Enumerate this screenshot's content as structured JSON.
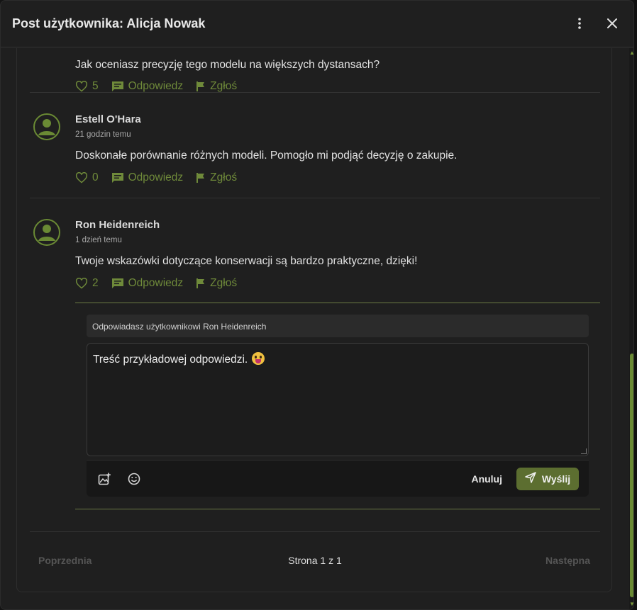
{
  "modal": {
    "title": "Post użytkownika: Alicja Nowak",
    "more_icon": "more-vertical-icon",
    "close_icon": "close-icon"
  },
  "comments": [
    {
      "text": "Jak oceniasz precyzję tego modelu na większych dystansach?",
      "likes": "5",
      "reply_label": "Odpowiedz",
      "report_label": "Zgłoś"
    },
    {
      "author": "Estell O'Hara",
      "time": "21 godzin temu",
      "text": "Doskonałe porównanie różnych modeli. Pomogło mi podjąć decyzję o zakupie.",
      "likes": "0",
      "reply_label": "Odpowiedz",
      "report_label": "Zgłoś"
    },
    {
      "author": "Ron Heidenreich",
      "time": "1 dzień temu",
      "text": "Twoje wskazówki dotyczące konserwacji są bardzo praktyczne, dzięki!",
      "likes": "2",
      "reply_label": "Odpowiedz",
      "report_label": "Zgłoś"
    }
  ],
  "reply_form": {
    "replying_to": "Odpowiadasz użytkownikowi Ron Heidenreich",
    "value": "Treść przykładowej odpowiedzi.",
    "emoji": "zany-face-emoji",
    "cancel_label": "Anuluj",
    "send_label": "Wyślij"
  },
  "pagination": {
    "prev_label": "Poprzednia",
    "page_label": "Strona 1 z 1",
    "next_label": "Następna"
  },
  "colors": {
    "accent": "#6f8a3a",
    "send_button": "#5c6e30",
    "background": "#1f1f1f"
  }
}
